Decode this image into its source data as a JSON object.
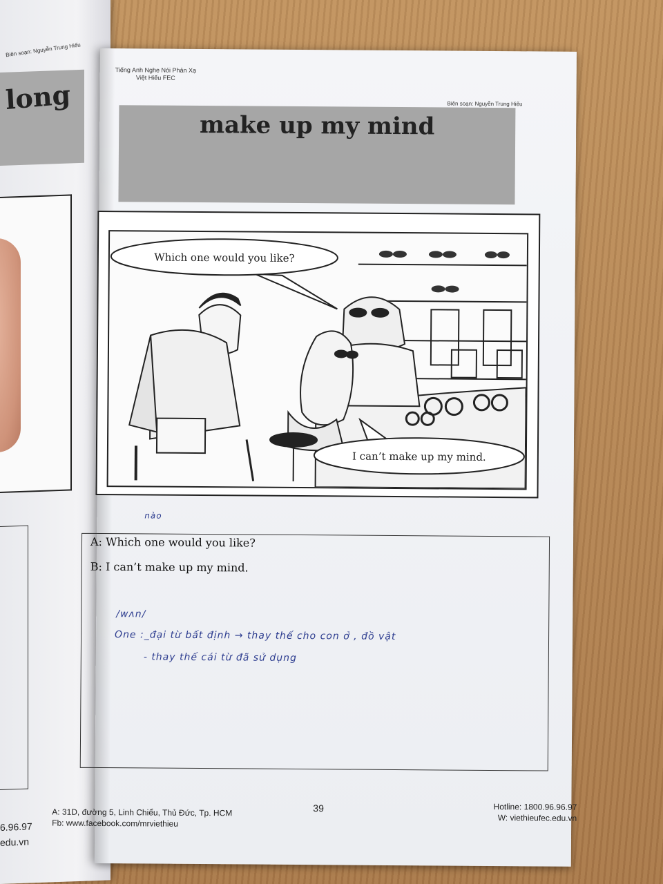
{
  "left_page": {
    "header": "Biên soạn: Nguyễn Trung Hiếu",
    "title": "long",
    "footer_phone": "6.96.97",
    "footer_web": "edu.vn"
  },
  "page": {
    "header_left_line1": "Tiếng Anh Nghe Nói Phản Xạ",
    "header_left_line2": "Việt Hiếu FEC",
    "header_right": "Biên soạn: Nguyễn Trung Hiếu",
    "title": "make up my mind",
    "comic": {
      "bubble_top": "Which one would you like?",
      "bubble_bottom": "I can’t make up my mind."
    },
    "dialogue": {
      "line_a": "A: Which one would you like?",
      "line_b": "B:  I can’t make up my mind."
    },
    "handwriting": {
      "note_above": "nào",
      "line1": "/wʌn/",
      "line2": "One :_đại từ bất định → thay thế cho con ở , đồ vật",
      "line3": "- thay thế cái từ đã sử dụng"
    },
    "page_number": "39",
    "footer_left_line1": "A: 31D, đường 5, Linh Chiểu, Thủ Đức, Tp. HCM",
    "footer_left_line2": "Fb: www.facebook.com/mrviethieu",
    "footer_right_line1": "Hotline: 1800.96.96.97",
    "footer_right_line2": "W: viethieufec.edu.vn"
  }
}
